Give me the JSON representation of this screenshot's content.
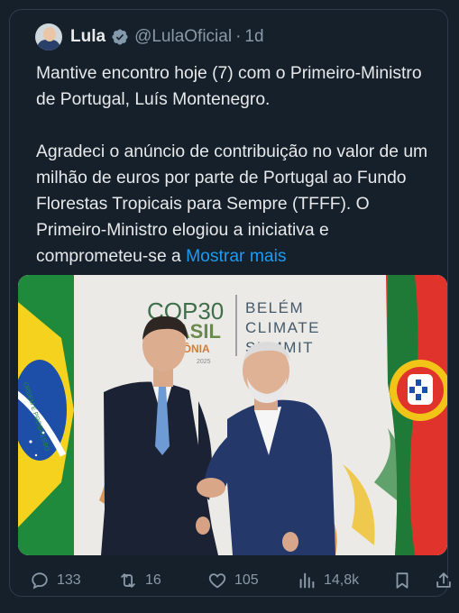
{
  "post": {
    "author_name": "Lula",
    "handle": "@LulaOficial",
    "separator": "·",
    "time": "1d",
    "paragraph1": "Mantive encontro hoje (7) com o Primeiro-Ministro de Portugal, Luís Montenegro.",
    "paragraph2": "Agradeci o anúncio de contribuição no valor de um milhão de euros por parte de Portugal ao Fundo Florestas Tropicais para Sempre (TFFF). O Primeiro-Ministro elogiou a iniciativa e comprometeu-se a",
    "show_more": "Mostrar mais"
  },
  "media": {
    "backdrop_logo_line1": "COP30",
    "backdrop_logo_line2": "BRASIL",
    "backdrop_logo_line3": "AMAZÔNIA",
    "backdrop_logo_line4": "2025",
    "backdrop_title_line1": "BELÉM",
    "backdrop_title_line2": "CLIMATE",
    "backdrop_title_line3": "SUMMIT",
    "flag_motto": "ORDEM E PROGRESSO"
  },
  "actions": {
    "replies": "133",
    "reposts": "16",
    "likes": "105",
    "views": "14,8k"
  },
  "colors": {
    "background": "#15202b",
    "accent": "#1d9bf0",
    "secondary_text": "#8b98a5"
  }
}
